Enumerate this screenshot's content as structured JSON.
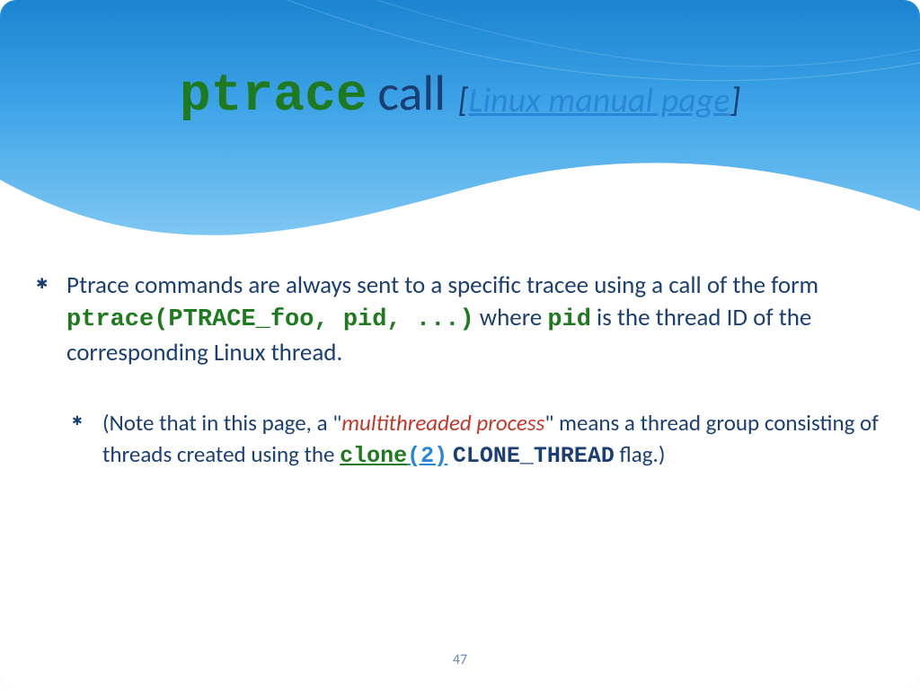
{
  "title": {
    "mono": "ptrace",
    "sans": "call",
    "bracket_open": "[",
    "link_text": "Linux manual page",
    "bracket_close": "]"
  },
  "bullet1": {
    "t1": "Ptrace commands are always sent to a specific tracee using a call of the form ",
    "code1": "ptrace(PTRACE_foo, pid, ...)",
    "t2": " where ",
    "code2": "pid",
    "t3": " is the thread ID of the corresponding Linux thread."
  },
  "bullet2": {
    "t1": " (Note that in this page, a \"",
    "red": "multithreaded process",
    "t2": "\" means a thread group consisting of threads created using the ",
    "link_name": "clone",
    "link_section": "(2)",
    "t3": " ",
    "code_flag": "CLONE_THREAD",
    "t4": " flag.)"
  },
  "page_number": "47"
}
